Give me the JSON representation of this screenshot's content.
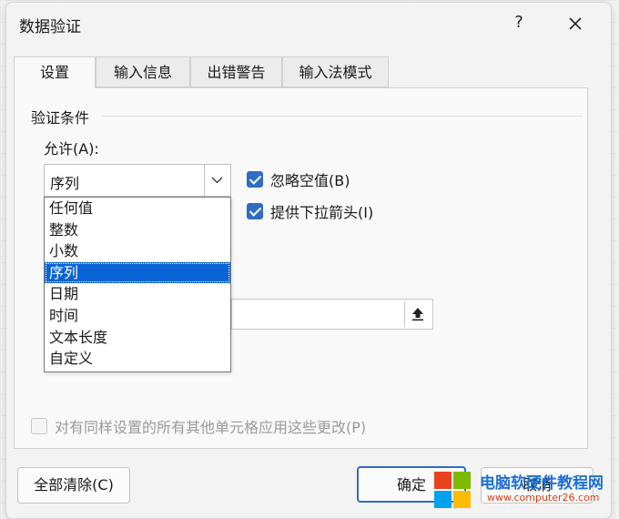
{
  "dialog": {
    "title": "数据验证",
    "help": "?"
  },
  "tabs": [
    {
      "label": "设置",
      "active": true
    },
    {
      "label": "输入信息",
      "active": false
    },
    {
      "label": "出错警告",
      "active": false
    },
    {
      "label": "输入法模式",
      "active": false
    }
  ],
  "settings": {
    "group_label": "验证条件",
    "allow_label": "允许(A):",
    "allow_value": "序列",
    "ignore_blank": {
      "label": "忽略空值(B)",
      "checked": true
    },
    "in_cell_dropdown": {
      "label": "提供下拉箭头(I)",
      "checked": true
    },
    "apply_all": {
      "label": "对有同样设置的所有其他单元格应用这些更改(P)",
      "checked": false,
      "disabled": true
    }
  },
  "dropdown_options": [
    "任何值",
    "整数",
    "小数",
    "序列",
    "日期",
    "时间",
    "文本长度",
    "自定义"
  ],
  "selected_option": "序列",
  "buttons": {
    "clear_all": "全部清除(C)",
    "ok": "确定",
    "cancel": "取消"
  },
  "watermark": {
    "title": "电脑软硬件教程网",
    "url": "www.computer26.com"
  },
  "colors": {
    "accent": "#2f6cc2",
    "selection": "#0a64d6"
  }
}
